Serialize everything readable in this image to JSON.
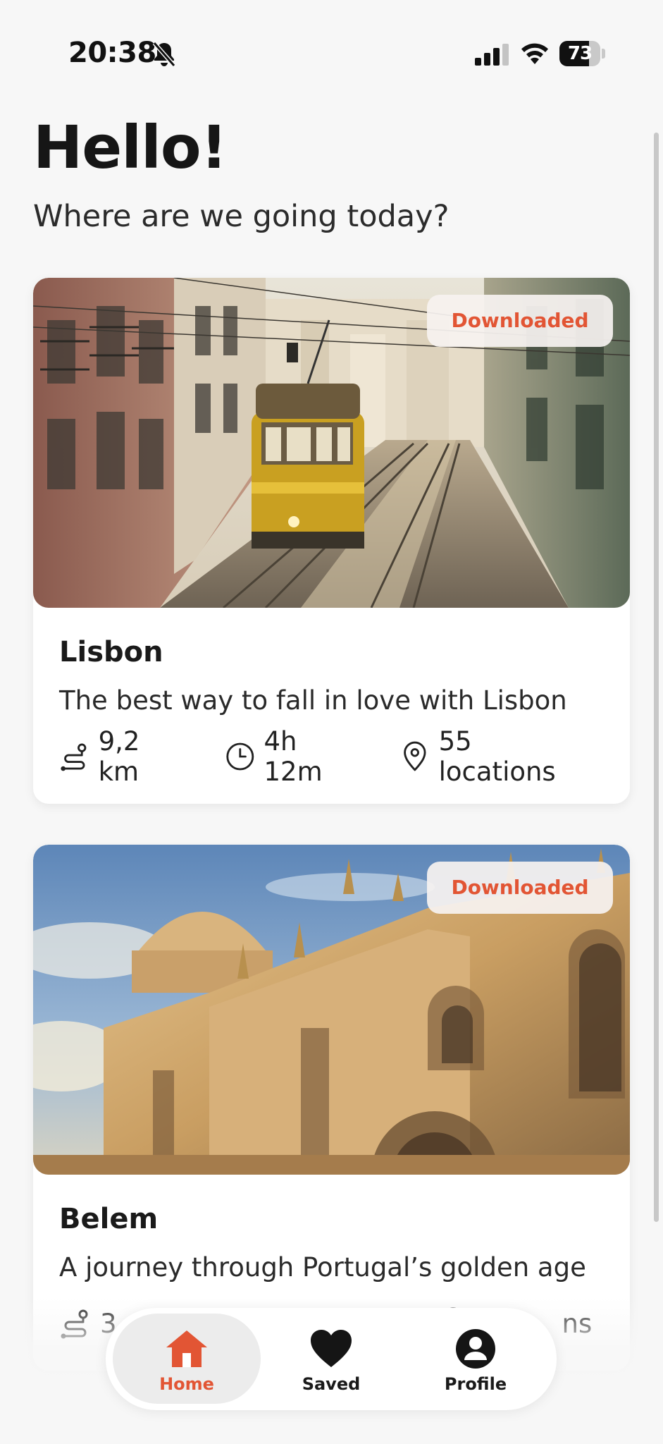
{
  "status_bar": {
    "time": "20:38",
    "battery": "73",
    "battery_level": 0.73,
    "icons": [
      "bell-slash-icon",
      "cellular-signal-icon",
      "wifi-icon",
      "battery-icon"
    ]
  },
  "header": {
    "greeting": "Hello!",
    "subtitle": "Where are we going today?"
  },
  "tours": [
    {
      "badge": "Downloaded",
      "title": "Lisbon",
      "description": "The best way to fall in love with Lisbon",
      "distance": "9,2 km",
      "duration": "4h 12m",
      "locations": "55 locations",
      "image": "lisbon-tram-street-photo"
    },
    {
      "badge": "Downloaded",
      "title": "Belem",
      "description": "A journey through Portugal’s golden age",
      "distance": "3",
      "duration": "",
      "locations": "ns",
      "image": "jeronimos-monastery-photo"
    }
  ],
  "nav": {
    "items": [
      {
        "label": "Home",
        "icon": "home-icon",
        "active": true
      },
      {
        "label": "Saved",
        "icon": "heart-icon",
        "active": false
      },
      {
        "label": "Profile",
        "icon": "user-circle-icon",
        "active": false
      }
    ]
  },
  "colors": {
    "accent": "#e25534",
    "background": "#f7f7f7",
    "card": "#ffffff"
  }
}
